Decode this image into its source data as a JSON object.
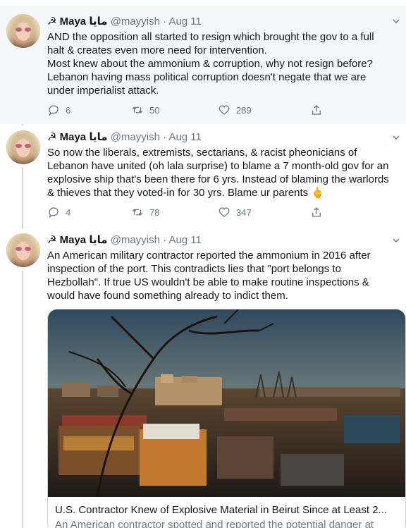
{
  "tweets": [
    {
      "author": {
        "emoji": "☭",
        "name": "Maya",
        "arabic_name": "مايا",
        "handle": "@mayyish",
        "date": "Aug 11"
      },
      "lines": [
        "AND the opposition all started to resign which brought the gov to a full",
        "halt & creates even more need for intervention.",
        "Most knew about the ammonium & corruption, why not resign before?",
        "Lebanon having mass political corruption doesn't negate that we are",
        "under imperialist attack."
      ],
      "replies": "6",
      "retweets": "50",
      "likes": "289"
    },
    {
      "author": {
        "emoji": "☭",
        "name": "Maya",
        "arabic_name": "مايا",
        "handle": "@mayyish",
        "date": "Aug 11"
      },
      "lines": [
        "So now the liberals, extremists, sectarians, & racist pheonicians of",
        "Lebanon have united (oh lala surprise) to blame a 7 month-old gov for an",
        "explosive ship that's been there for 6 yrs. Instead of blaming the warlords",
        "& thieves that they voted-in for 30 yrs. Blame ur parents 🖕"
      ],
      "replies": "4",
      "retweets": "78",
      "likes": "347"
    },
    {
      "author": {
        "emoji": "☭",
        "name": "Maya",
        "arabic_name": "مايا",
        "handle": "@mayyish",
        "date": "Aug 11"
      },
      "lines": [
        "An American military contractor reported the ammonium in 2016 after",
        "inspection of the port. This contradicts lies that \"port belongs to",
        "Hezbollah\". If true US wouldn't be able to make routine inspections &",
        "would have found something already to indict them."
      ],
      "card": {
        "title": "U.S. Contractor Knew of Explosive Material in Beirut Since at Least 2...",
        "description": "An American contractor spotted and reported the potential danger at"
      }
    }
  ],
  "colors": {
    "text": "#14171a",
    "secondary": "#657786",
    "border": "#ccd6dd",
    "highlight_bg": "#f5f8fa"
  },
  "icons": [
    "reply-icon",
    "retweet-icon",
    "like-icon",
    "share-icon",
    "chevron-down-icon"
  ]
}
